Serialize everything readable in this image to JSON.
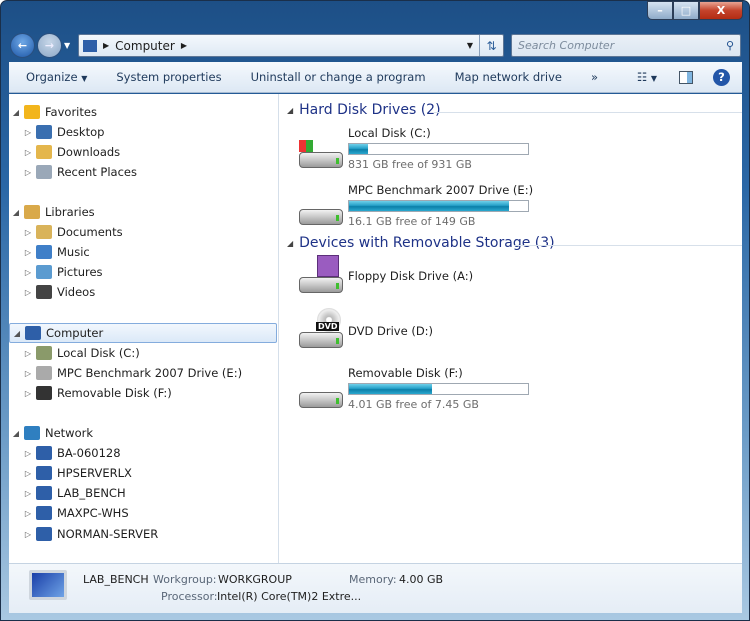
{
  "window": {
    "minimize": "–",
    "maximize": "□",
    "close": "X"
  },
  "address": {
    "path": "Computer",
    "search_placeholder": "Search Computer"
  },
  "toolbar": {
    "organize": "Organize",
    "system_properties": "System properties",
    "uninstall": "Uninstall or change a program",
    "map_drive": "Map network drive",
    "more": "»"
  },
  "sidebar": [
    {
      "label": "Favorites",
      "level": 0,
      "icon": "star-icon",
      "color": "#f2b51c"
    },
    {
      "label": "Desktop",
      "level": 1,
      "icon": "desktop-icon",
      "color": "#3a6fb0"
    },
    {
      "label": "Downloads",
      "level": 1,
      "icon": "downloads-folder-icon",
      "color": "#e4b64c"
    },
    {
      "label": "Recent Places",
      "level": 1,
      "icon": "recent-places-icon",
      "color": "#9aa8b8"
    },
    {
      "label": "Libraries",
      "level": 0,
      "icon": "libraries-icon",
      "color": "#d9a94a"
    },
    {
      "label": "Documents",
      "level": 1,
      "icon": "documents-icon",
      "color": "#d9b35a"
    },
    {
      "label": "Music",
      "level": 1,
      "icon": "music-icon",
      "color": "#3f7fc8"
    },
    {
      "label": "Pictures",
      "level": 1,
      "icon": "pictures-icon",
      "color": "#5b9bd0"
    },
    {
      "label": "Videos",
      "level": 1,
      "icon": "videos-icon",
      "color": "#444"
    },
    {
      "label": "Computer",
      "level": 0,
      "icon": "computer-icon",
      "color": "#2e5fa8",
      "selected": true
    },
    {
      "label": "Local Disk (C:)",
      "level": 1,
      "icon": "local-disk-icon",
      "color": "#8a9a6a"
    },
    {
      "label": "MPC Benchmark 2007 Drive (E:)",
      "level": 1,
      "icon": "hard-drive-icon",
      "color": "#aaa"
    },
    {
      "label": "Removable Disk (F:)",
      "level": 1,
      "icon": "removable-disk-icon",
      "color": "#333"
    },
    {
      "label": "Network",
      "level": 0,
      "icon": "network-icon",
      "color": "#2f7fc0"
    },
    {
      "label": "BA-060128",
      "level": 1,
      "icon": "network-computer-icon",
      "color": "#2e5fa8"
    },
    {
      "label": "HPSERVERLX",
      "level": 1,
      "icon": "network-computer-icon",
      "color": "#2e5fa8"
    },
    {
      "label": "LAB_BENCH",
      "level": 1,
      "icon": "network-computer-icon",
      "color": "#2e5fa8"
    },
    {
      "label": "MAXPC-WHS",
      "level": 1,
      "icon": "network-computer-icon",
      "color": "#2e5fa8"
    },
    {
      "label": "NORMAN-SERVER",
      "level": 1,
      "icon": "network-computer-icon",
      "color": "#2e5fa8"
    }
  ],
  "groups": [
    {
      "title": "Hard Disk Drives (2)",
      "items": [
        {
          "name": "Local Disk (C:)",
          "free": "831 GB free of 931 GB",
          "used_fraction": 0.107,
          "icon": "windows-drive-icon"
        },
        {
          "name": "MPC Benchmark 2007 Drive (E:)",
          "free": "16.1 GB free of 149 GB",
          "used_fraction": 0.892,
          "icon": "hard-drive-icon"
        }
      ]
    },
    {
      "title": "Devices with Removable Storage (3)",
      "items": [
        {
          "name": "Floppy Disk Drive (A:)",
          "icon": "floppy-drive-icon"
        },
        {
          "name": "DVD Drive (D:)",
          "icon": "dvd-drive-icon",
          "badge": "DVD"
        },
        {
          "name": "Removable Disk (F:)",
          "free": "4.01 GB free of 7.45 GB",
          "used_fraction": 0.462,
          "icon": "removable-disk-icon"
        }
      ]
    }
  ],
  "details": {
    "computer_name": "LAB_BENCH",
    "workgroup_label": "Workgroup:",
    "workgroup": "WORKGROUP",
    "memory_label": "Memory:",
    "memory": "4.00 GB",
    "processor_label": "Processor:",
    "processor": "Intel(R) Core(TM)2 Extre..."
  },
  "colors": {
    "accent": "#1e3287",
    "bar": "#26a0c8"
  }
}
